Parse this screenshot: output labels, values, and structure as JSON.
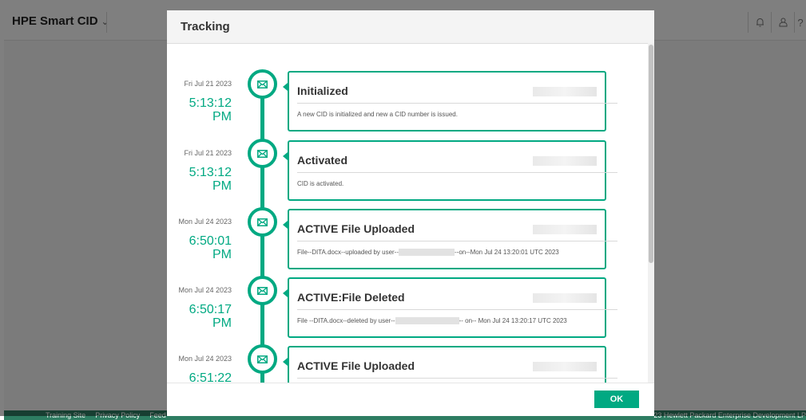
{
  "app": {
    "title": "HPE Smart CID",
    "footer_links": [
      "Training Site",
      "Privacy Policy",
      "Feed"
    ],
    "footer_copyright": "23 Hewlett Packard Enterprise Development LP"
  },
  "modal": {
    "title": "Tracking",
    "ok_label": "OK"
  },
  "colors": {
    "accent": "#01a982",
    "footer": "#2e7d62"
  },
  "timeline": [
    {
      "date": "Fri Jul 21 2023",
      "time_line1": "5:13:12",
      "time_line2": "PM",
      "title": "Initialized",
      "desc_parts": [
        "A new CID is initialized and new a CID number is issued."
      ],
      "icon": "mail-icon"
    },
    {
      "date": "Fri Jul 21 2023",
      "time_line1": "5:13:12",
      "time_line2": "PM",
      "title": "Activated",
      "desc_parts": [
        "CID is activated."
      ],
      "icon": "mail-icon"
    },
    {
      "date": "Mon Jul 24 2023",
      "time_line1": "6:50:01",
      "time_line2": "PM",
      "title": "ACTIVE File Uploaded",
      "desc_parts": [
        "File--DITA.docx--uploaded by user--",
        "--on--Mon Jul 24 13:20:01 UTC 2023"
      ],
      "icon": "mail-icon"
    },
    {
      "date": "Mon Jul 24 2023",
      "time_line1": "6:50:17",
      "time_line2": "PM",
      "title": "ACTIVE:File Deleted",
      "desc_parts": [
        "File --DITA.docx--deleted by user--",
        "-- on-- Mon Jul 24 13:20:17 UTC 2023"
      ],
      "icon": "mail-icon"
    },
    {
      "date": "Mon Jul 24 2023",
      "time_line1": "6:51:22",
      "time_line2": "",
      "title": "ACTIVE File Uploaded",
      "desc_parts": [
        ""
      ],
      "icon": "mail-icon"
    }
  ]
}
